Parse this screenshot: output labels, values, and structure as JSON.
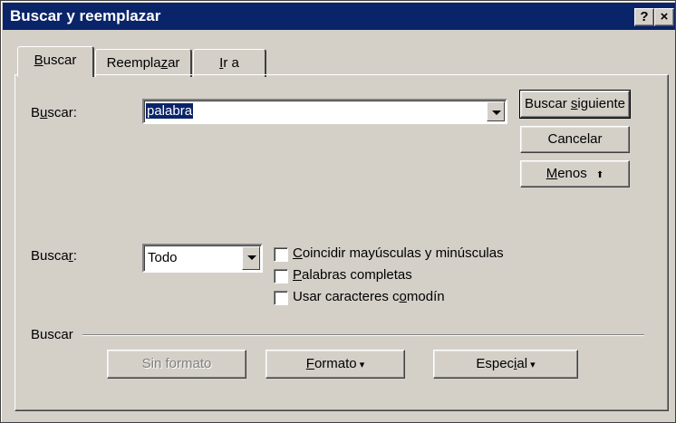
{
  "window": {
    "title": "Buscar y reemplazar",
    "help_btn": "?",
    "close_btn": "×"
  },
  "tabs": [
    {
      "pre": "",
      "key": "B",
      "post": "uscar"
    },
    {
      "pre": "Reempla",
      "key": "z",
      "post": "ar"
    },
    {
      "pre": "",
      "key": "I",
      "post": "r a"
    }
  ],
  "find": {
    "label_pre": "B",
    "label_key": "u",
    "label_post": "scar:",
    "value": "palabra"
  },
  "buttons": {
    "find_next_pre": "Buscar ",
    "find_next_key": "s",
    "find_next_post": "iguiente",
    "cancel": "Cancelar",
    "less_key": "M",
    "less_post": "enos",
    "less_arrow": "⬆"
  },
  "search": {
    "label_pre": "Busca",
    "label_key": "r",
    "label_post": ":",
    "direction": "Todo"
  },
  "options": [
    {
      "key": "C",
      "post": "oincidir mayúsculas y minúsculas"
    },
    {
      "key": "P",
      "post": "alabras completas"
    },
    {
      "pre": "Usar caracteres c",
      "key": "o",
      "post": "modín"
    }
  ],
  "section": {
    "title": "Buscar"
  },
  "bottom_buttons": {
    "no_format": "Sin formato",
    "format_key": "F",
    "format_post": "ormato",
    "special_pre": "Espec",
    "special_key": "i",
    "special_post": "al"
  }
}
